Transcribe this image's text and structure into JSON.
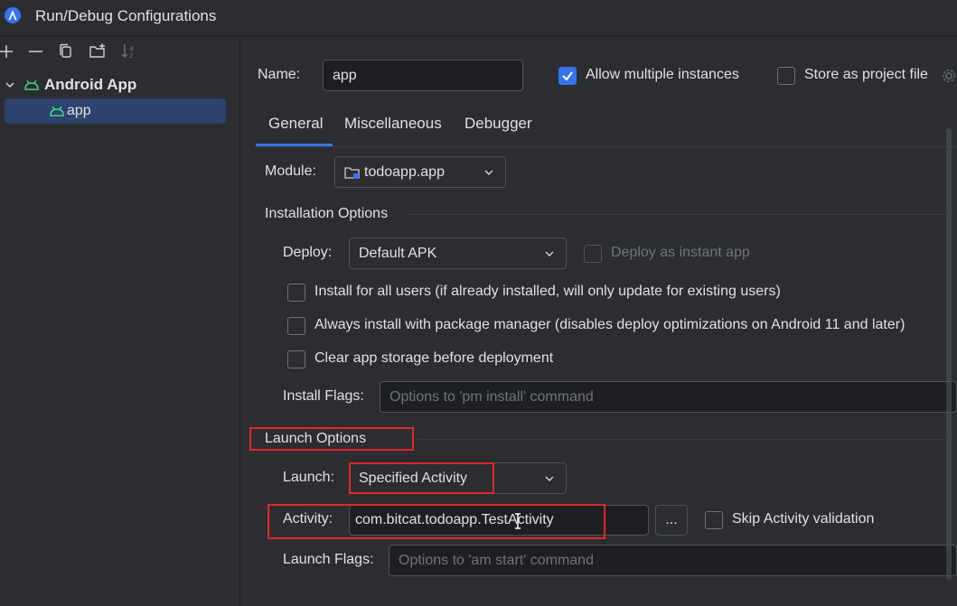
{
  "window": {
    "title": "Run/Debug Configurations"
  },
  "toolbar": {
    "icons": [
      "plus-icon",
      "minus-icon",
      "copy-icon",
      "new-folder-icon",
      "sort-icon"
    ]
  },
  "tree": {
    "root": {
      "label": "Android App",
      "icon": "android-icon"
    },
    "child": {
      "label": "app",
      "icon": "android-icon"
    }
  },
  "name": {
    "label": "Name:",
    "value": "app",
    "allow_multiple_label": "Allow multiple instances",
    "allow_multiple_checked": true,
    "store_label": "Store as project file",
    "store_checked": false
  },
  "tabs": [
    {
      "label": "General",
      "active": true
    },
    {
      "label": "Miscellaneous",
      "active": false
    },
    {
      "label": "Debugger",
      "active": false
    }
  ],
  "module": {
    "label": "Module:",
    "value": "todoapp.app"
  },
  "installation": {
    "heading": "Installation Options",
    "deploy_label": "Deploy:",
    "deploy_value": "Default APK",
    "instant_label": "Deploy as instant app",
    "options": [
      {
        "label": "Install for all users (if already installed, will only update for existing users)",
        "checked": false
      },
      {
        "label": "Always install with package manager (disables deploy optimizations on Android 11 and later)",
        "checked": false
      },
      {
        "label": "Clear app storage before deployment",
        "checked": false
      }
    ],
    "flags_label": "Install Flags:",
    "flags_placeholder": "Options to 'pm install' command"
  },
  "launch": {
    "heading": "Launch Options",
    "launch_label": "Launch:",
    "launch_value": "Specified Activity",
    "activity_label": "Activity:",
    "activity_value": "com.bitcat.todoapp.TestActivity",
    "browse_label": "...",
    "skip_label": "Skip Activity validation",
    "skip_checked": false,
    "flags_label": "Launch Flags:",
    "flags_placeholder": "Options to 'am start' command"
  },
  "colors": {
    "accent": "#3574f0",
    "highlight_box": "#e0262b",
    "selection": "#2e436e",
    "android_green": "#3ddc84"
  }
}
